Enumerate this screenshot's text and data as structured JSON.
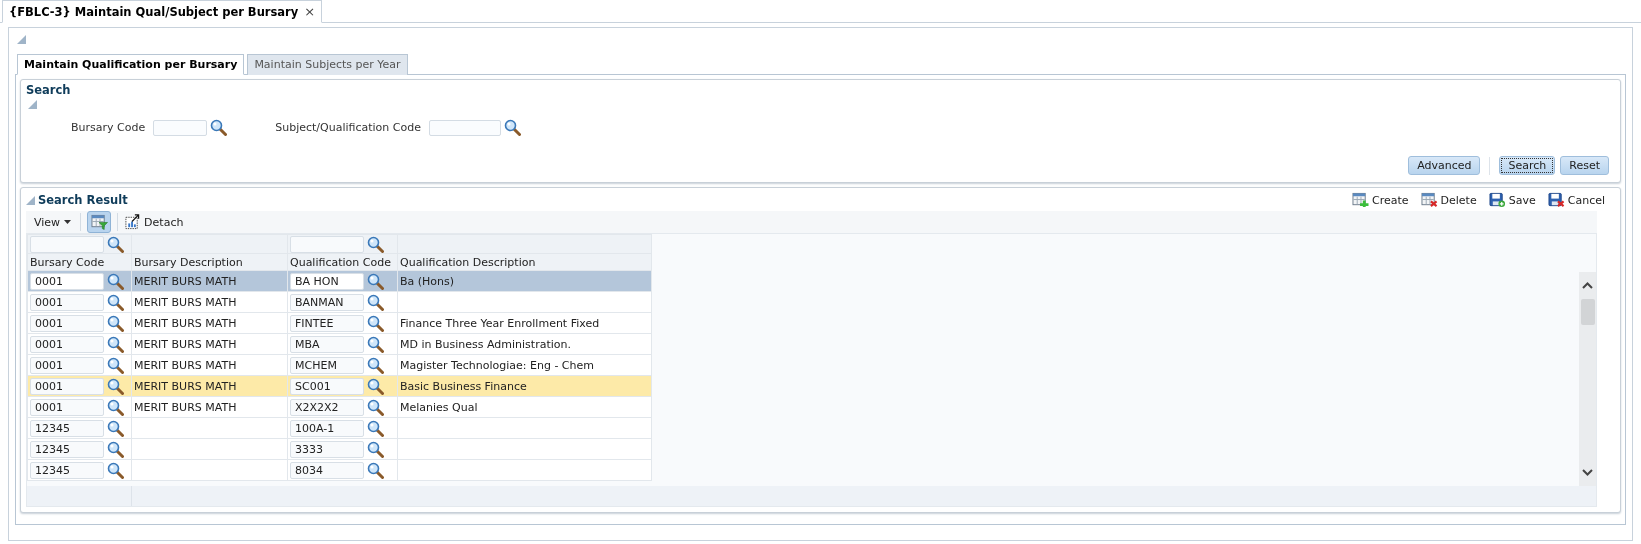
{
  "document_tab": {
    "title": "{FBLC-3} Maintain Qual/Subject per Bursary",
    "close": "×"
  },
  "tabs": [
    {
      "label": "Maintain Qualification per Bursary",
      "selected": true
    },
    {
      "label": "Maintain Subjects per Year",
      "selected": false
    }
  ],
  "search": {
    "title": "Search",
    "fields": [
      {
        "label": "Bursary Code"
      },
      {
        "label": "Subject/Qualification Code"
      }
    ],
    "buttons": [
      {
        "label": "Advanced",
        "focused": false
      },
      {
        "label": "Search",
        "focused": true
      },
      {
        "label": "Reset",
        "focused": false
      }
    ]
  },
  "results": {
    "title": "Search Result",
    "actions": [
      {
        "label": "Create",
        "kind": "create"
      },
      {
        "label": "Delete",
        "kind": "delete"
      },
      {
        "label": "Save",
        "kind": "save"
      },
      {
        "label": "Cancel",
        "kind": "cancel"
      }
    ],
    "toolbar": {
      "view": "View",
      "filter_on": true,
      "detach": "Detach"
    },
    "columns": [
      {
        "label": "Bursary Code",
        "kind": "lookup"
      },
      {
        "label": "Bursary Description",
        "kind": "text"
      },
      {
        "label": "Qualification Code",
        "kind": "lookup"
      },
      {
        "label": "Qualification Description",
        "kind": "text"
      }
    ],
    "rows": [
      {
        "cells": [
          "0001",
          "MERIT BURS MATH",
          "BA HON",
          "Ba (Hons)"
        ],
        "selected": true,
        "highlighted": false
      },
      {
        "cells": [
          "0001",
          "MERIT BURS MATH",
          "BANMAN"
        ],
        "selected": false,
        "highlighted": false
      },
      {
        "cells": [
          "0001",
          "MERIT BURS MATH",
          "FINTEE",
          "Finance Three Year Enrollment Fixed"
        ],
        "selected": false,
        "highlighted": false
      },
      {
        "cells": [
          "0001",
          "MERIT BURS MATH",
          "MBA",
          "MD in Business Administration."
        ],
        "selected": false,
        "highlighted": false
      },
      {
        "cells": [
          "0001",
          "MERIT BURS MATH",
          "MCHEM",
          "Magister Technologiae: Eng - Chem"
        ],
        "selected": false,
        "highlighted": false
      },
      {
        "cells": [
          "0001",
          "MERIT BURS MATH",
          "SC001",
          "Basic Business Finance"
        ],
        "selected": false,
        "highlighted": true
      },
      {
        "cells": [
          "0001",
          "MERIT BURS MATH",
          "X2X2X2",
          "Melanies Qual"
        ],
        "selected": false,
        "highlighted": false
      },
      {
        "cells": [
          "12345",
          "",
          "100A-1"
        ],
        "selected": false,
        "highlighted": false
      },
      {
        "cells": [
          "12345",
          "",
          "3333"
        ],
        "selected": false,
        "highlighted": false
      },
      {
        "cells": [
          "12345",
          "",
          "8034"
        ],
        "selected": false,
        "highlighted": false
      }
    ]
  }
}
